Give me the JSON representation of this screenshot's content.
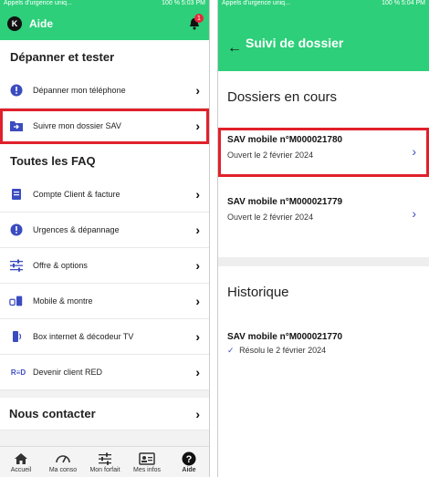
{
  "left": {
    "status_left": "Appels d'urgence uniq...",
    "status_right": "100 % 5:03 PM",
    "header_title": "Aide",
    "logo_letter": "K",
    "badge_count": "1",
    "section1_title": "Dépanner et tester",
    "section1_items": [
      {
        "label": "Dépanner mon téléphone"
      },
      {
        "label": "Suivre mon dossier SAV"
      }
    ],
    "section2_title": "Toutes les FAQ",
    "section2_items": [
      {
        "label": "Compte Client & facture"
      },
      {
        "label": "Urgences & dépannage"
      },
      {
        "label": "Offre & options"
      },
      {
        "label": "Mobile & montre"
      },
      {
        "label": "Box internet & décodeur TV"
      },
      {
        "label": "Devenir client RED"
      }
    ],
    "contact_title": "Nous contacter",
    "nav": [
      {
        "label": "Accueil"
      },
      {
        "label": "Ma conso"
      },
      {
        "label": "Mon forfait"
      },
      {
        "label": "Mes infos"
      },
      {
        "label": "Aide"
      }
    ],
    "red_logo": "R≡D"
  },
  "right": {
    "status_left": "Appels d'urgence uniq...",
    "status_right": "100 % 5:04 PM",
    "header_title": "Suivi de dossier",
    "current_title": "Dossiers en cours",
    "current": [
      {
        "title": "SAV mobile n°M000021780",
        "status": "Ouvert",
        "date": "le 2 février 2024"
      },
      {
        "title": "SAV mobile n°M000021779",
        "status": "Ouvert",
        "date": "le 2 février 2024"
      }
    ],
    "history_title": "Historique",
    "history": [
      {
        "title": "SAV mobile n°M000021770",
        "status": "Résolu le 2 février 2024"
      }
    ]
  },
  "colors": {
    "brand_green": "#2ecf7a",
    "highlight_red": "#e0212b",
    "accent_blue": "#3b4cc0"
  }
}
